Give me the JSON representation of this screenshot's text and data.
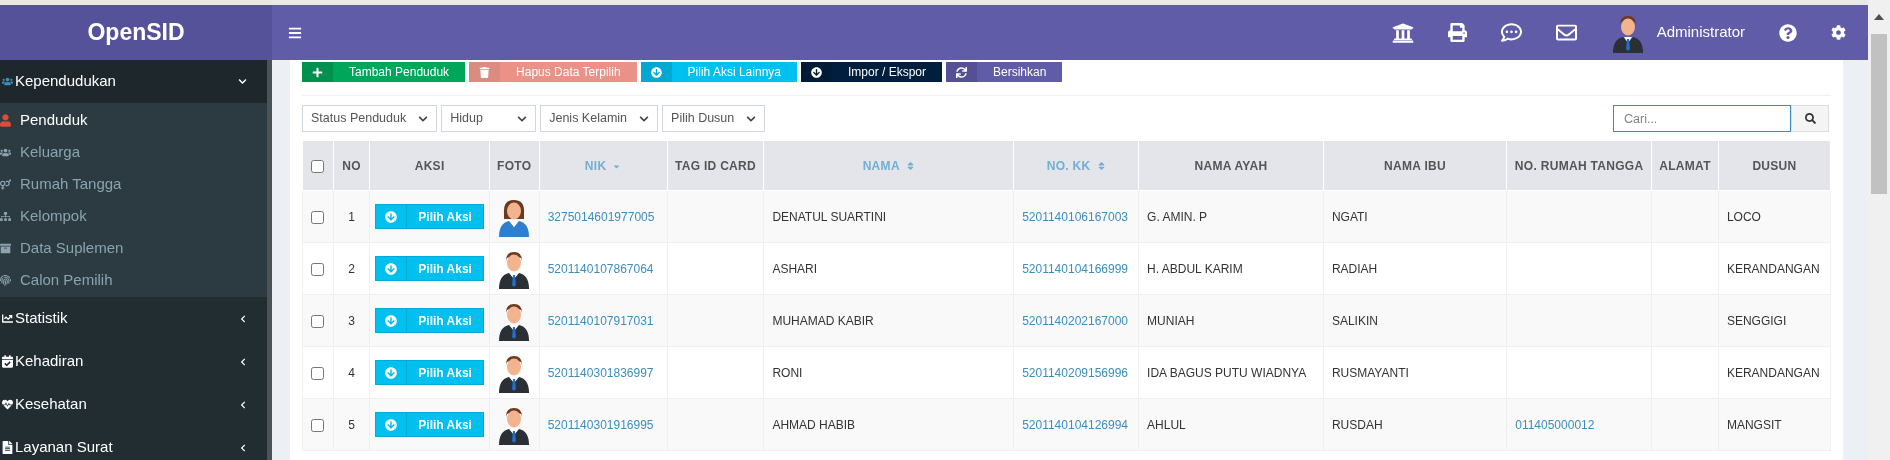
{
  "logo": "OpenSID",
  "header": {
    "user": "Administrator"
  },
  "sidebar": {
    "items": [
      {
        "label": "Kependudukan",
        "expanded": true,
        "children": [
          {
            "label": "Penduduk",
            "selected": true
          },
          {
            "label": "Keluarga",
            "selected": false
          },
          {
            "label": "Rumah Tangga",
            "selected": false
          },
          {
            "label": "Kelompok",
            "selected": false
          },
          {
            "label": "Data Suplemen",
            "selected": false
          },
          {
            "label": "Calon Pemilih",
            "selected": false
          }
        ]
      },
      {
        "label": "Statistik",
        "expanded": false
      },
      {
        "label": "Kehadiran",
        "expanded": false
      },
      {
        "label": "Kesehatan",
        "expanded": false
      },
      {
        "label": "Layanan Surat",
        "expanded": false
      }
    ]
  },
  "toolbar": [
    {
      "label": "Tambah Penduduk",
      "kind": "add",
      "disabled": false
    },
    {
      "label": "Hapus Data Terpilih",
      "kind": "delete",
      "disabled": true
    },
    {
      "label": "Pilih Aksi Lainnya",
      "kind": "more",
      "disabled": false
    },
    {
      "label": "Impor / Ekspor",
      "kind": "import",
      "disabled": false
    },
    {
      "label": "Bersihkan",
      "kind": "clear",
      "disabled": false
    }
  ],
  "filters": [
    "Status Penduduk",
    "Hidup",
    "Jenis Kelamin",
    "Pilih Dusun"
  ],
  "search": {
    "placeholder": "Cari..."
  },
  "table": {
    "select_all_checked": false,
    "columns": [
      {
        "label": "NO",
        "sortable": false
      },
      {
        "label": "AKSI",
        "sortable": false
      },
      {
        "label": "FOTO",
        "sortable": false
      },
      {
        "label": "NIK",
        "sortable": true,
        "sorted": true
      },
      {
        "label": "TAG ID CARD",
        "sortable": false
      },
      {
        "label": "NAMA",
        "sortable": true,
        "sorted": false
      },
      {
        "label": "NO. KK",
        "sortable": true,
        "sorted": false
      },
      {
        "label": "NAMA AYAH",
        "sortable": false
      },
      {
        "label": "NAMA IBU",
        "sortable": false
      },
      {
        "label": "NO. RUMAH TANGGA",
        "sortable": false
      },
      {
        "label": "ALAMAT",
        "sortable": false
      },
      {
        "label": "DUSUN",
        "sortable": false
      }
    ],
    "rows": [
      {
        "checked": false,
        "no": "1",
        "action": "Pilih Aksi",
        "kind": "female",
        "nik": "3275014601977005",
        "nama": "DENATUL SUARTINI",
        "no_kk": "5201140106167003",
        "nama_ayah": "G. AMIN. P",
        "nama_ibu": "NGATI",
        "dusun": "LOCO"
      },
      {
        "checked": false,
        "no": "2",
        "action": "Pilih Aksi",
        "kind": "male",
        "nik": "5201140107867064",
        "nama": "ASHARI",
        "no_kk": "5201140104166999",
        "nama_ayah": "H. ABDUL KARIM",
        "nama_ibu": "RADIAH",
        "dusun": "KERANDANGAN"
      },
      {
        "checked": false,
        "no": "3",
        "action": "Pilih Aksi",
        "kind": "male",
        "nik": "5201140107917031",
        "nama": "MUHAMAD KABIR",
        "no_kk": "5201140202167000",
        "nama_ayah": "MUNIAH",
        "nama_ibu": "SALIKIN",
        "dusun": "SENGGIGI"
      },
      {
        "checked": false,
        "no": "4",
        "action": "Pilih Aksi",
        "kind": "male",
        "nik": "5201140301836997",
        "nama": "RONI",
        "no_kk": "5201140209156996",
        "nama_ayah": "IDA BAGUS PUTU WIADNYA",
        "nama_ibu": "RUSMAYANTI",
        "dusun": "KERANDANGAN"
      },
      {
        "checked": false,
        "no": "5",
        "action": "Pilih Aksi",
        "kind": "male",
        "nik": "5201140301916995",
        "nama": "AHMAD HABIB",
        "no_kk": "5201140104126994",
        "nama_ayah": "AHLUL",
        "nama_ibu": "RUSDAH",
        "no_rumah_tangga": "011405000012",
        "dusun": "MANGSIT"
      }
    ]
  }
}
